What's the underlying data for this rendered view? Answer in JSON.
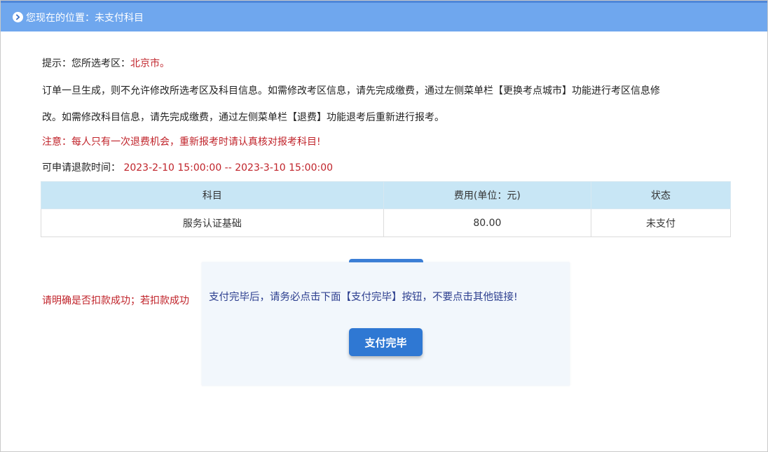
{
  "breadcrumb": {
    "prefix": "您现在的位置：",
    "current": "未支付科目",
    "icon": "circle-chevron-right-icon"
  },
  "notice": {
    "region_label": "提示：您所选考区：",
    "region_value": "北京市。",
    "order_line_1": "订单一旦生成，则不允许修改所选考区及科目信息。如需修改考区信息，请先完成缴费，通过左侧菜单栏【更换考点城市】功能进行考区信息修",
    "order_line_2": "改。如需修改科目信息，请先完成缴费，通过左侧菜单栏【退费】功能退考后重新进行报考。",
    "refund_warning": "注意：每人只有一次退费机会，重新报考时请认真核对报考科目!",
    "refund_time_label": "可申请退款时间：",
    "refund_time_value": "2023-2-10 15:00:00 -- 2023-3-10 15:00:00"
  },
  "table": {
    "headers": [
      "科目",
      "费用(单位：元)",
      "状态"
    ],
    "rows": [
      [
        "服务认证基础",
        "80.00",
        "未支付"
      ]
    ]
  },
  "bottom_warning": "请明确是否扣款成功；若扣款成功",
  "modal": {
    "message": "支付完毕后，请务必点击下面【支付完毕】按钮，不要点击其他链接!",
    "button_label": "支付完毕"
  },
  "colors": {
    "header_bar": "#6fa7ee",
    "accent_red": "#c0232a",
    "table_header": "#c8e6f5",
    "button_blue": "#2f78d3",
    "modal_text": "#2d3f8f"
  }
}
